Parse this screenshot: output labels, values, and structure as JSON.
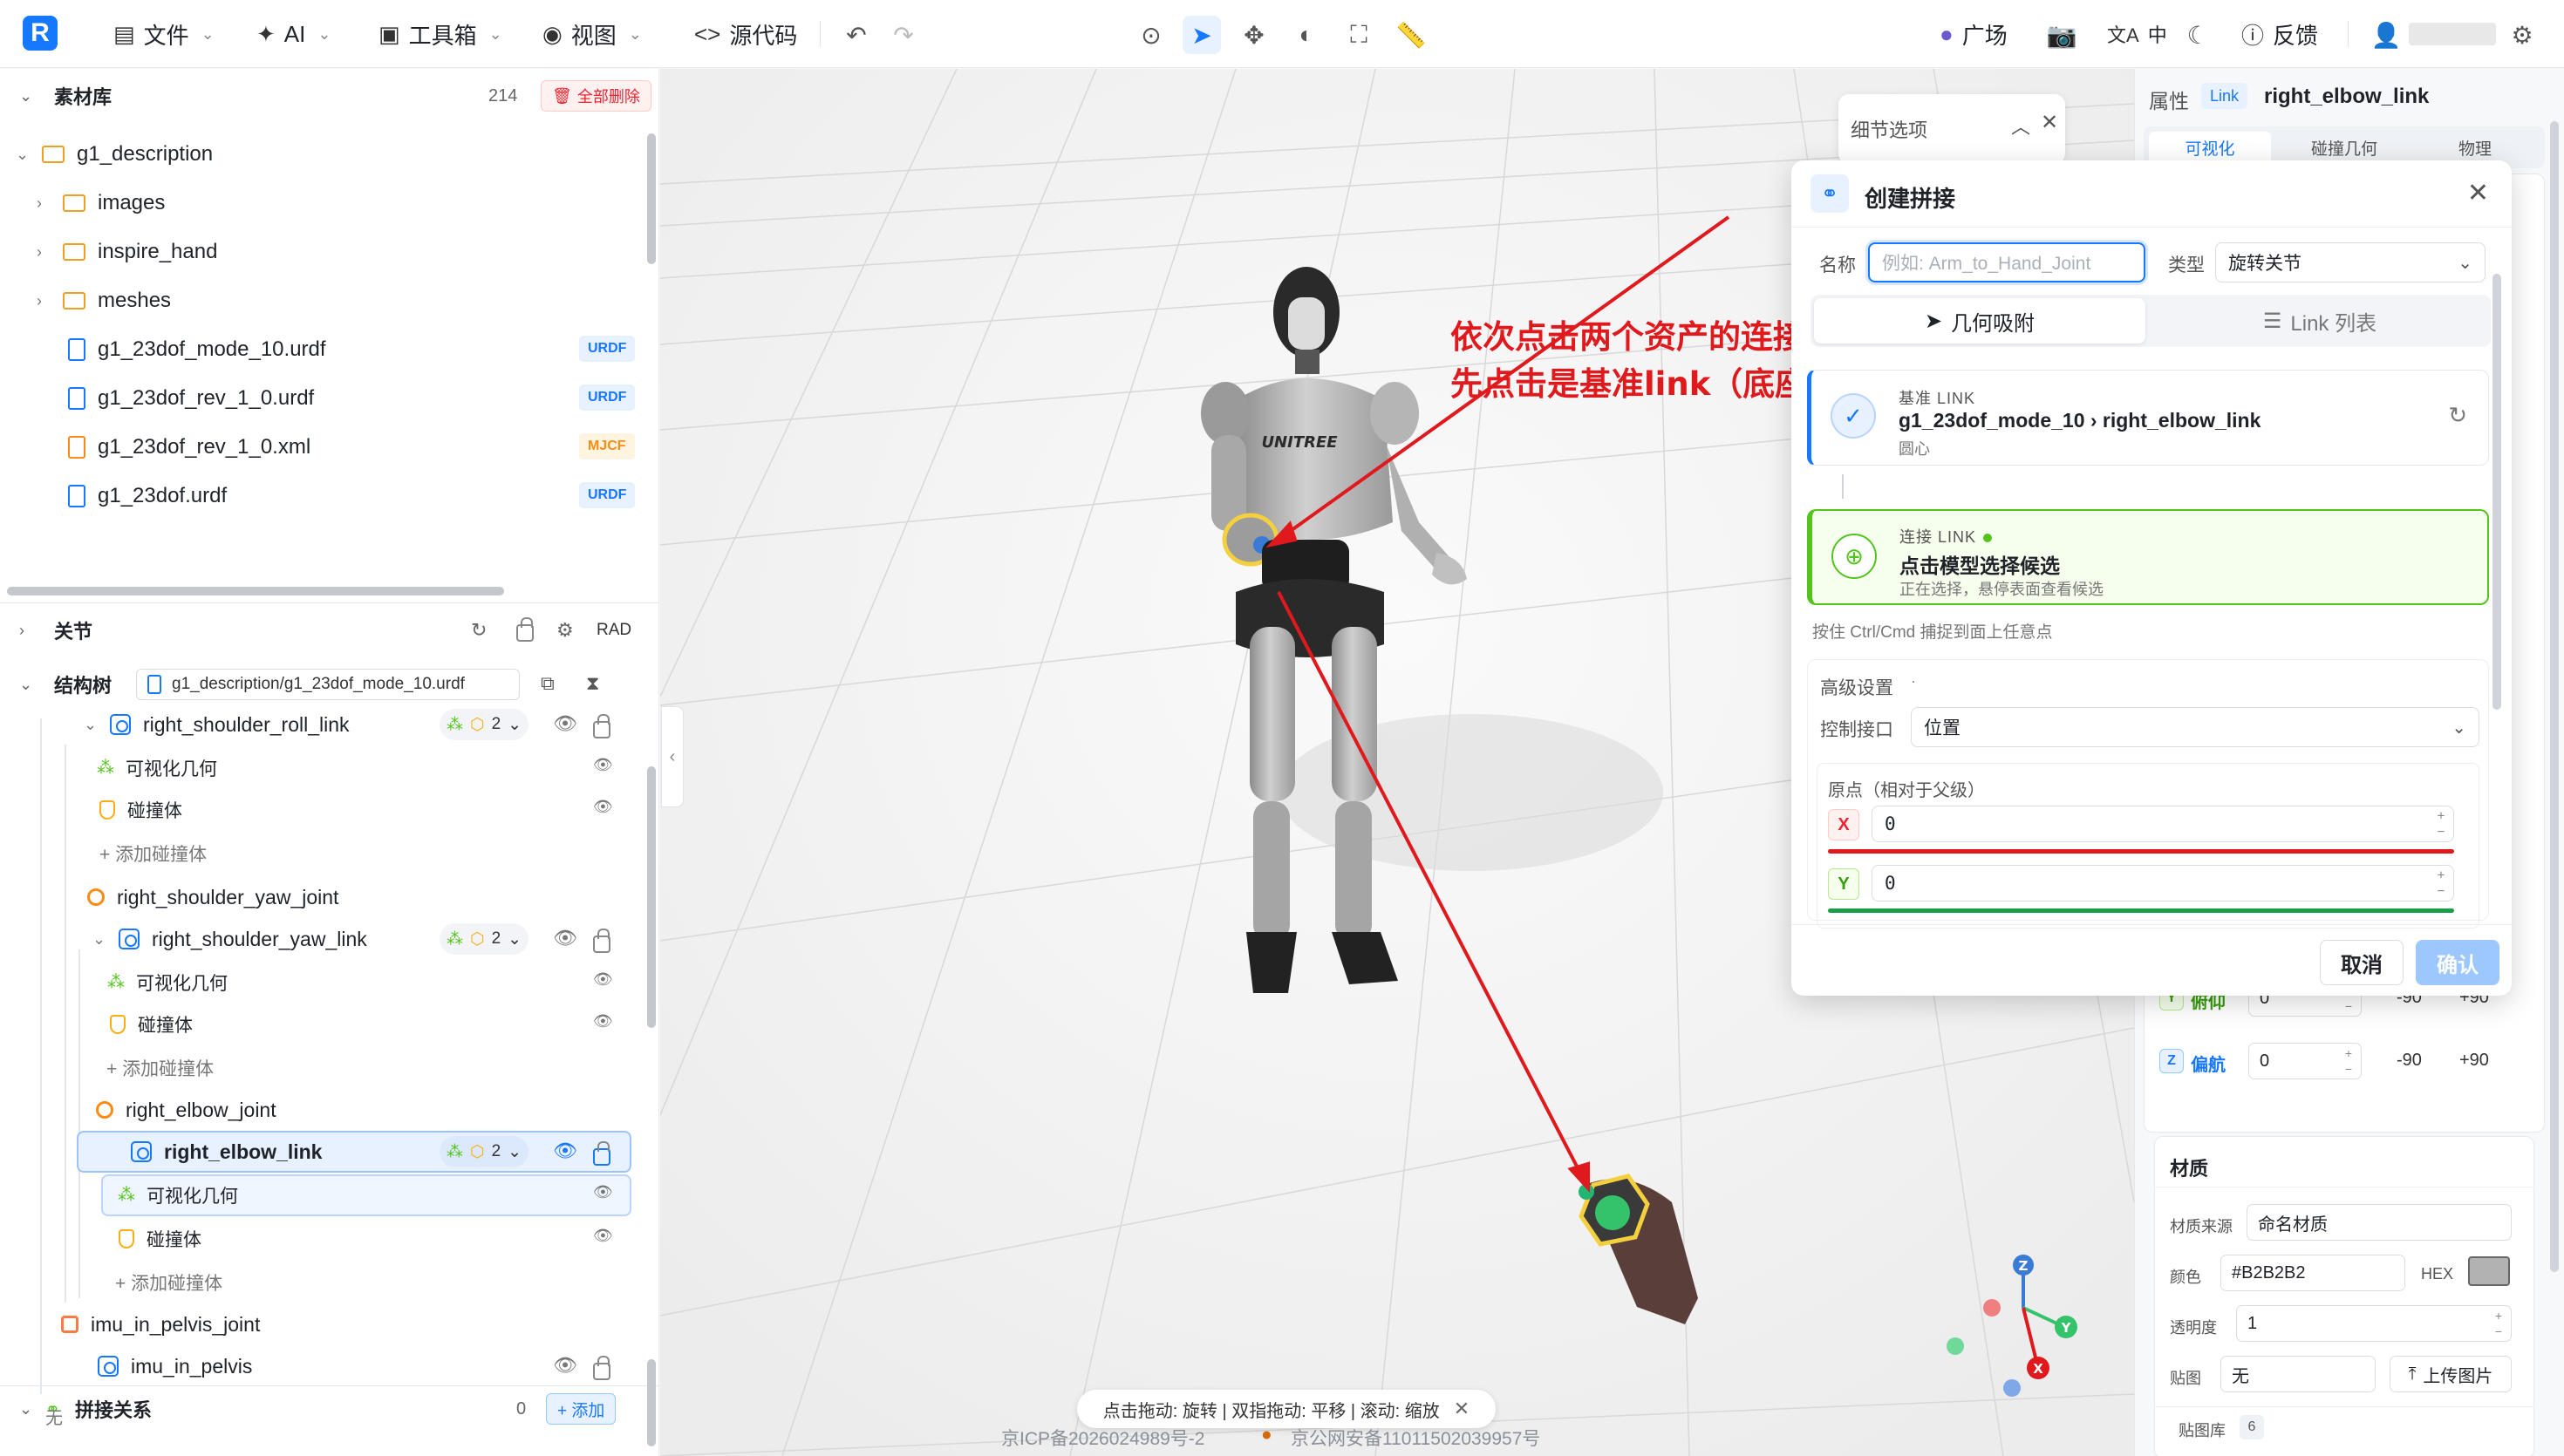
{
  "toolbar": {
    "logo": "R",
    "menus": [
      {
        "icon": "file-icon",
        "label": "文件"
      },
      {
        "icon": "ai-icon",
        "label": "AI"
      },
      {
        "icon": "toolbox-icon",
        "label": "工具箱"
      },
      {
        "icon": "eye-icon",
        "label": "视图"
      },
      {
        "icon": "code-icon",
        "label": "源代码"
      }
    ],
    "plaza_label": "广场",
    "lang_label": "中",
    "feedback_label": "反馈"
  },
  "assets": {
    "title": "素材库",
    "count": "214",
    "delete_all": "全部删除",
    "root": "g1_description",
    "folders": [
      "images",
      "inspire_hand",
      "meshes"
    ],
    "files": [
      {
        "name": "g1_23dof_mode_10.urdf",
        "badge": "URDF"
      },
      {
        "name": "g1_23dof_rev_1_0.urdf",
        "badge": "URDF"
      },
      {
        "name": "g1_23dof_rev_1_0.xml",
        "badge": "MJCF"
      },
      {
        "name": "g1_23dof.urdf",
        "badge": "URDF"
      }
    ]
  },
  "joints_section": {
    "title": "关节",
    "unit": "RAD"
  },
  "structure": {
    "title": "结构树",
    "path": "g1_description/g1_23dof_mode_10.urdf",
    "rows": [
      {
        "text": "right_shoulder_roll_link",
        "count": "2"
      },
      {
        "text": "可视化几何"
      },
      {
        "text": "碰撞体"
      },
      {
        "text": "+ 添加碰撞体"
      },
      {
        "text": "right_shoulder_yaw_joint"
      },
      {
        "text": "right_shoulder_yaw_link",
        "count": "2"
      },
      {
        "text": "可视化几何"
      },
      {
        "text": "碰撞体"
      },
      {
        "text": "+ 添加碰撞体"
      },
      {
        "text": "right_elbow_joint"
      },
      {
        "text": "right_elbow_link",
        "count": "2"
      },
      {
        "text": "可视化几何"
      },
      {
        "text": "碰撞体"
      },
      {
        "text": "+ 添加碰撞体"
      },
      {
        "text": "imu_in_pelvis_joint"
      },
      {
        "text": "imu_in_pelvis"
      }
    ]
  },
  "splice": {
    "title": "拼接关系",
    "count": "0",
    "add_label": "+ 添加",
    "empty": "无"
  },
  "viewport": {
    "annotation_line1": "依次点击两个资产的连接点",
    "annotation_line2": "先点击是基准link（底座）",
    "robot_brand": "UNITREE",
    "hint_bar": "点击拖动: 旋转 | 双指拖动: 平移 | 滚动: 缩放",
    "icp": "京ICP备2026024989号-2",
    "police": "京公网安备11011502039957号",
    "gizmo": {
      "z": "Z",
      "y": "Y",
      "x": "X"
    }
  },
  "detail_options": {
    "title": "细节选项"
  },
  "dialog": {
    "title": "创建拼接",
    "name_label": "名称",
    "name_placeholder": "例如: Arm_to_Hand_Joint",
    "type_label": "类型",
    "type_value": "旋转关节",
    "tab_geometry": "几何吸附",
    "tab_links": "Link 列表",
    "base_caption": "基准 LINK",
    "base_value": "g1_23dof_mode_10 › right_elbow_link",
    "base_sub": "圆心",
    "conn_caption": "连接 LINK",
    "conn_value": "点击模型选择候选",
    "conn_sub": "正在选择，悬停表面查看候选",
    "ctrl_hint": "按住 Ctrl/Cmd 捕捉到面上任意点",
    "advanced_label": "高级设置",
    "control_label": "控制接口",
    "control_value": "位置",
    "origin_label": "原点（相对于父级）",
    "x_label": "X",
    "x_value": "0",
    "y_label": "Y",
    "y_value": "0",
    "cancel": "取消",
    "confirm": "确认"
  },
  "properties": {
    "title": "属性",
    "kind": "Link",
    "name": "right_elbow_link",
    "tabs": [
      "可视化",
      "碰撞几何",
      "物理"
    ],
    "pitch_label": "俯仰",
    "pitch_value": "0",
    "yaw_label": "偏航",
    "yaw_value": "0",
    "min": "-90",
    "max": "+90",
    "material_title": "材质",
    "source_label": "材质来源",
    "source_value": "命名材质",
    "color_label": "颜色",
    "color_value": "#B2B2B2",
    "hex_label": "HEX",
    "opacity_label": "透明度",
    "opacity_value": "1",
    "texture_label": "贴图",
    "texture_value": "无",
    "upload_label": "上传图片",
    "library_label": "贴图库",
    "library_count": "6"
  },
  "colors": {
    "accent": "#1677ff",
    "annotation": "#e0191d",
    "connect": "#52c41a",
    "material": "#B2B2B2"
  }
}
